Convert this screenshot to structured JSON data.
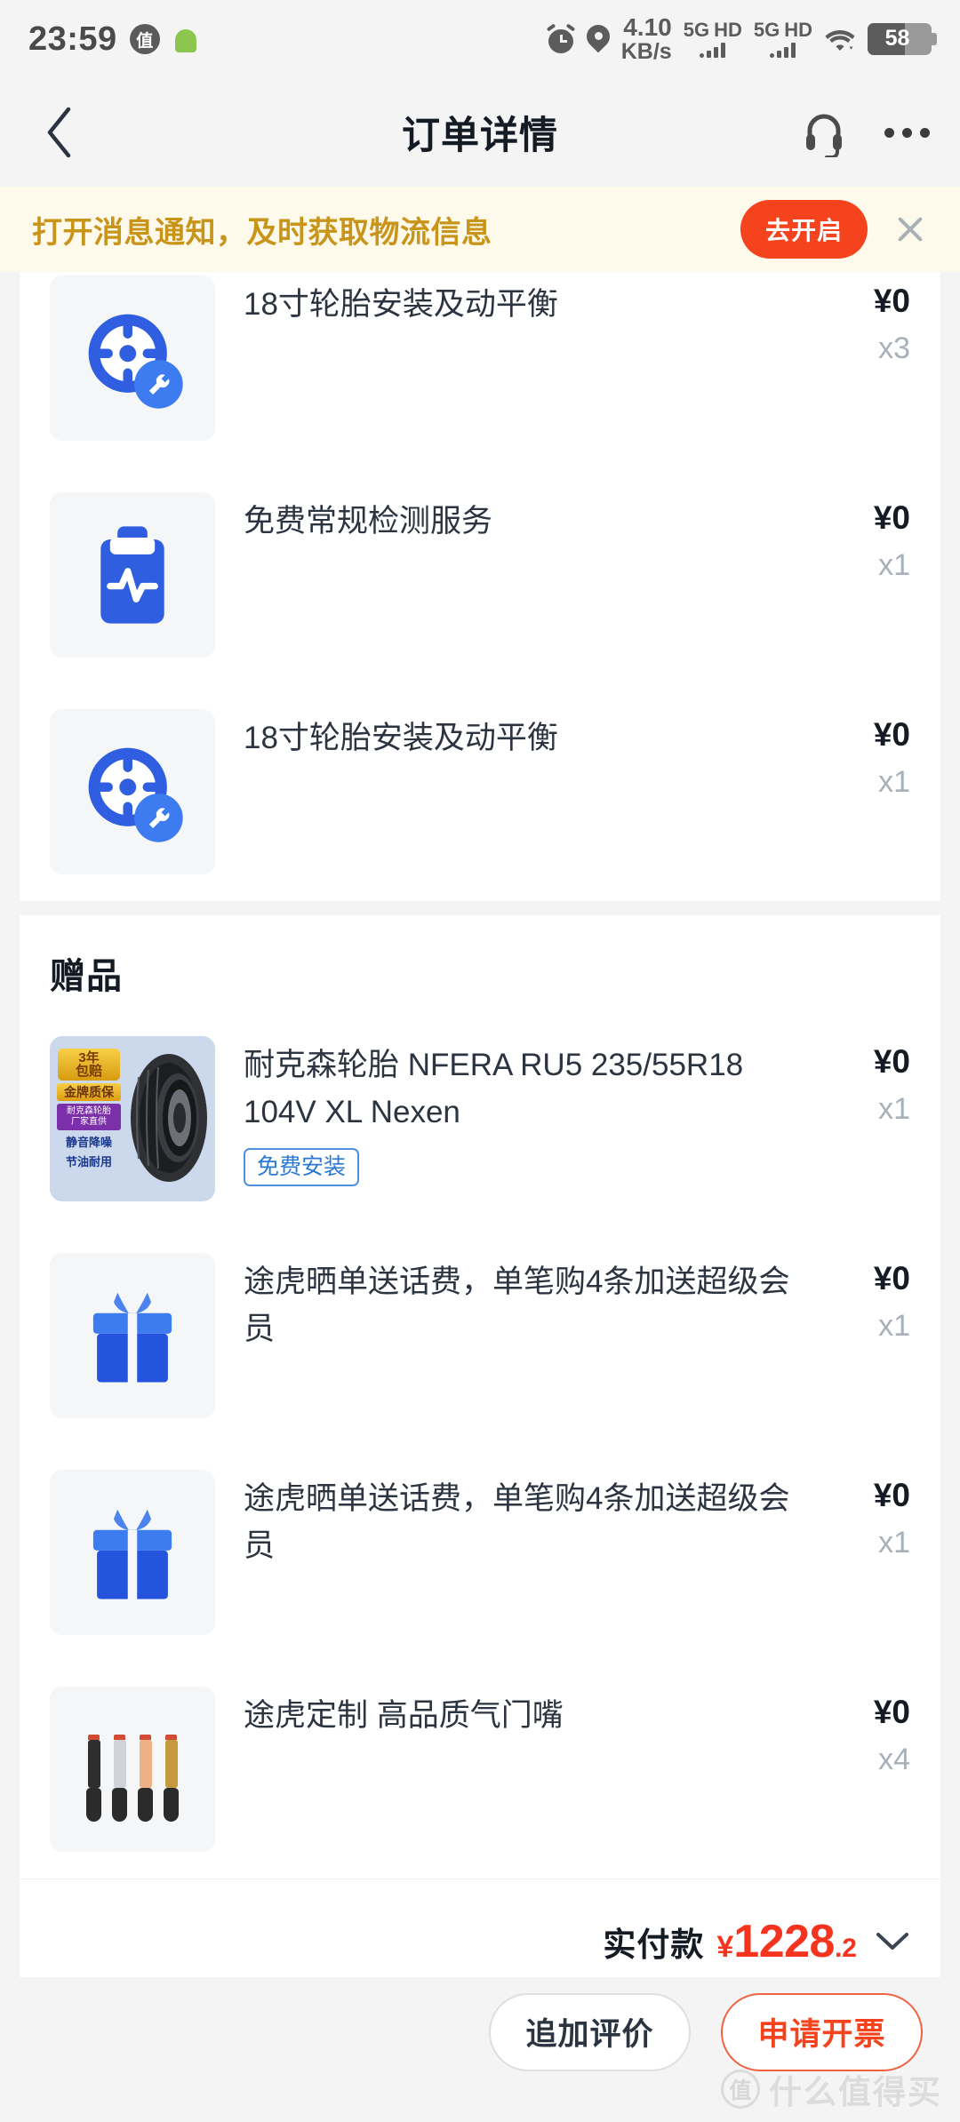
{
  "status_bar": {
    "time": "23:59",
    "app_badge": "值",
    "android_icon": "android-robot-icon",
    "alarm_icon": "alarm-clock-icon",
    "location_icon": "location-pin-icon",
    "net_speed_value": "4.10",
    "net_speed_unit": "KB/s",
    "sim1_network": "5G",
    "sim1_hd": "HD",
    "sim2_network": "5G",
    "sim2_hd": "HD",
    "wifi_icon": "wifi-icon",
    "battery_percent": "58"
  },
  "nav": {
    "back_icon": "chevron-left-icon",
    "title": "订单详情",
    "support_icon": "headset-icon",
    "more_icon": "more-horizontal-icon"
  },
  "banner": {
    "text": "打开消息通知，及时获取物流信息",
    "action_label": "去开启",
    "close_icon": "close-icon",
    "bg_color": "#fdfaec",
    "text_color": "#c8941a",
    "button_color": "#f5431e"
  },
  "services": {
    "items": [
      {
        "icon": "tire-wrench-icon",
        "title": "18寸轮胎安装及动平衡",
        "price": "¥0",
        "qty": "x3"
      },
      {
        "icon": "clipboard-pulse-icon",
        "title": "免费常规检测服务",
        "price": "¥0",
        "qty": "x1"
      },
      {
        "icon": "tire-wrench-icon",
        "title": "18寸轮胎安装及动平衡",
        "price": "¥0",
        "qty": "x1"
      }
    ]
  },
  "gifts": {
    "section_title": "赠品",
    "items": [
      {
        "icon": "tire-product-photo",
        "title": "耐克森轮胎 NFERA RU5 235/55R18 104V XL Nexen",
        "badge": "免费安装",
        "price": "¥0",
        "qty": "x1",
        "thumb_promo": {
          "years": "3年",
          "years_sub": "包赔",
          "gold": "金牌质保",
          "brand_tag": "耐克森轮胎",
          "brand_sub": "厂家直供",
          "feature1": "静音降噪",
          "feature2": "节油耐用"
        }
      },
      {
        "icon": "gift-box-icon",
        "title": "途虎晒单送话费，单笔购4条加送超级会员",
        "price": "¥0",
        "qty": "x1"
      },
      {
        "icon": "gift-box-icon",
        "title": "途虎晒单送话费，单笔购4条加送超级会员",
        "price": "¥0",
        "qty": "x1"
      },
      {
        "icon": "valve-stem-photo",
        "title": "途虎定制 高品质气门嘴",
        "price": "¥0",
        "qty": "x4"
      }
    ]
  },
  "total": {
    "label": "实付款",
    "currency": "¥",
    "integer": "1228",
    "decimal": ".2",
    "expand_icon": "chevron-down-icon",
    "color": "#f5341f"
  },
  "footer": {
    "secondary_label": "追加评价",
    "primary_label": "申请开票"
  },
  "watermark": {
    "mark": "值",
    "text": "什么值得买"
  }
}
